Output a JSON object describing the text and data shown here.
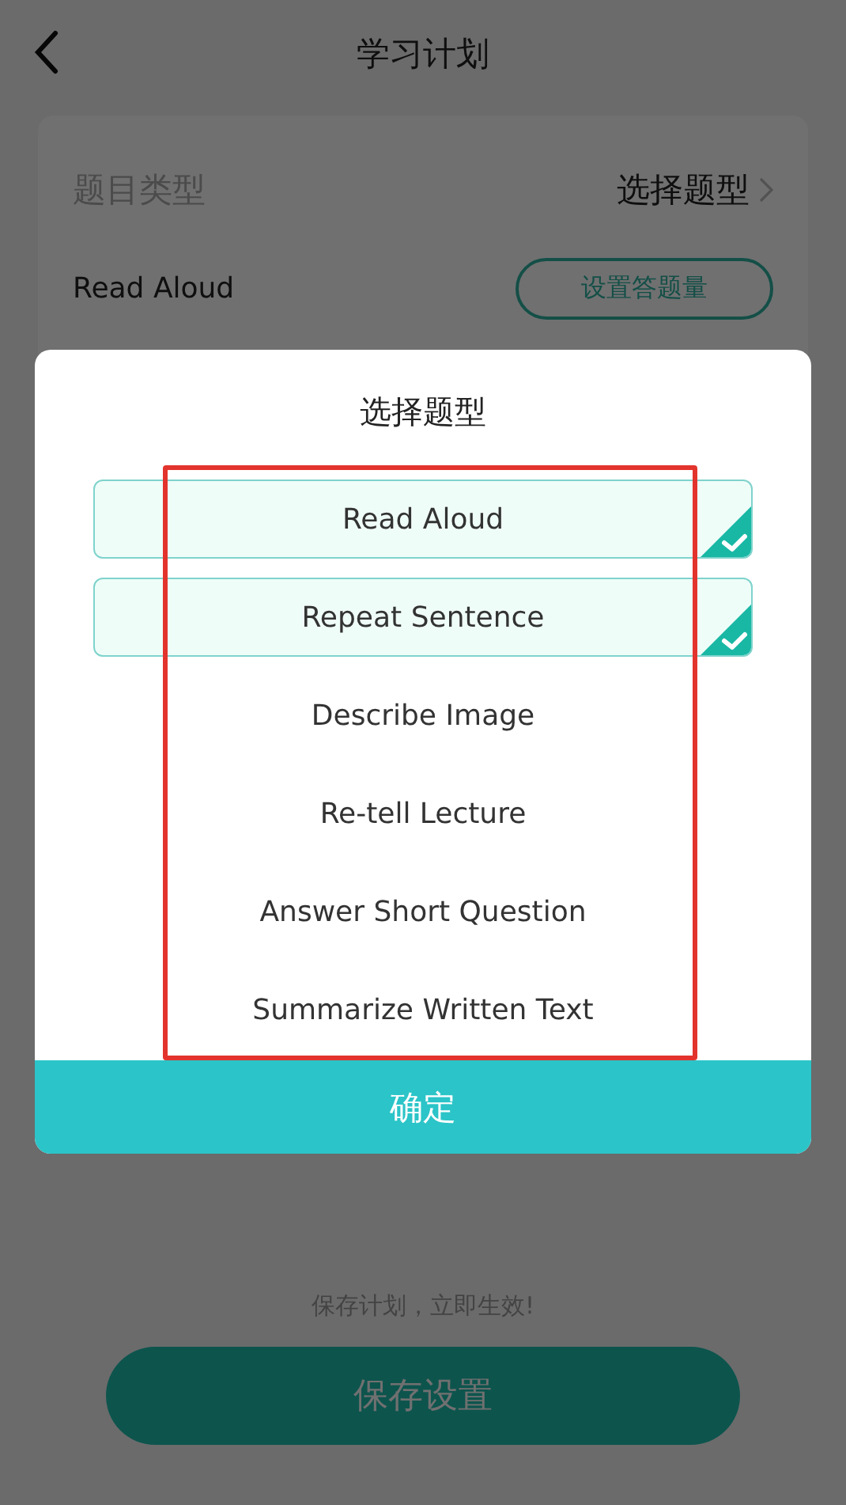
{
  "header": {
    "title": "学习计划"
  },
  "plan_card": {
    "type_label": "题目类型",
    "type_value": "选择题型",
    "item_name": "Read Aloud",
    "item_button": "设置答题量"
  },
  "footer": {
    "hint": "保存计划，立即生效!",
    "save_button": "保存设置"
  },
  "dialog": {
    "title": "选择题型",
    "options": [
      {
        "label": "Read Aloud",
        "selected": true
      },
      {
        "label": "Repeat Sentence",
        "selected": true
      },
      {
        "label": "Describe Image",
        "selected": false
      },
      {
        "label": "Re-tell Lecture",
        "selected": false
      },
      {
        "label": "Answer Short Question",
        "selected": false
      },
      {
        "label": "Summarize Written Text",
        "selected": false
      }
    ],
    "confirm_button": "确定"
  }
}
